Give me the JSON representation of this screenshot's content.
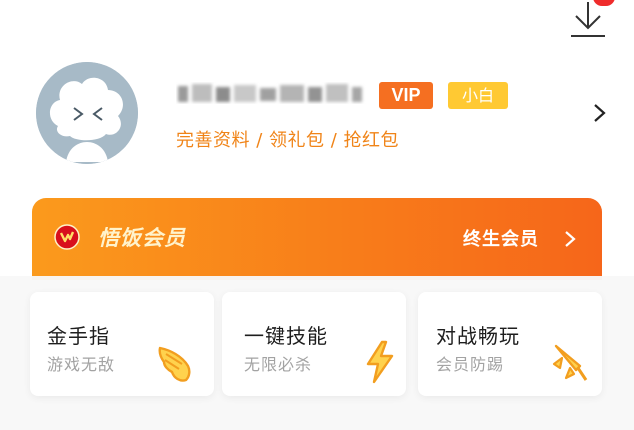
{
  "top": {
    "download_icon": "download-icon",
    "notification_dot_color": "#ef2b2b"
  },
  "profile": {
    "avatar_icon": "default-avatar",
    "badge_vip": "VIP",
    "badge_rank": "小白",
    "links": "完善资料 / 领礼包 / 抢红包",
    "chevron_icon": "chevron-right-icon"
  },
  "member": {
    "title": "悟饭会员",
    "lifetime": "终生会员",
    "icon": "crown-shield-icon"
  },
  "features": [
    {
      "title": "金手指",
      "subtitle": "游戏无敌",
      "icon": "wing-icon"
    },
    {
      "title": "一键技能",
      "subtitle": "无限必杀",
      "icon": "lightning-icon"
    },
    {
      "title": "对战畅玩",
      "subtitle": "会员防踢",
      "icon": "rocket-icon"
    }
  ],
  "colors": {
    "accent": "#f56f21",
    "rank": "#ffc933",
    "link": "#f08418",
    "icon": "#f5a623"
  }
}
